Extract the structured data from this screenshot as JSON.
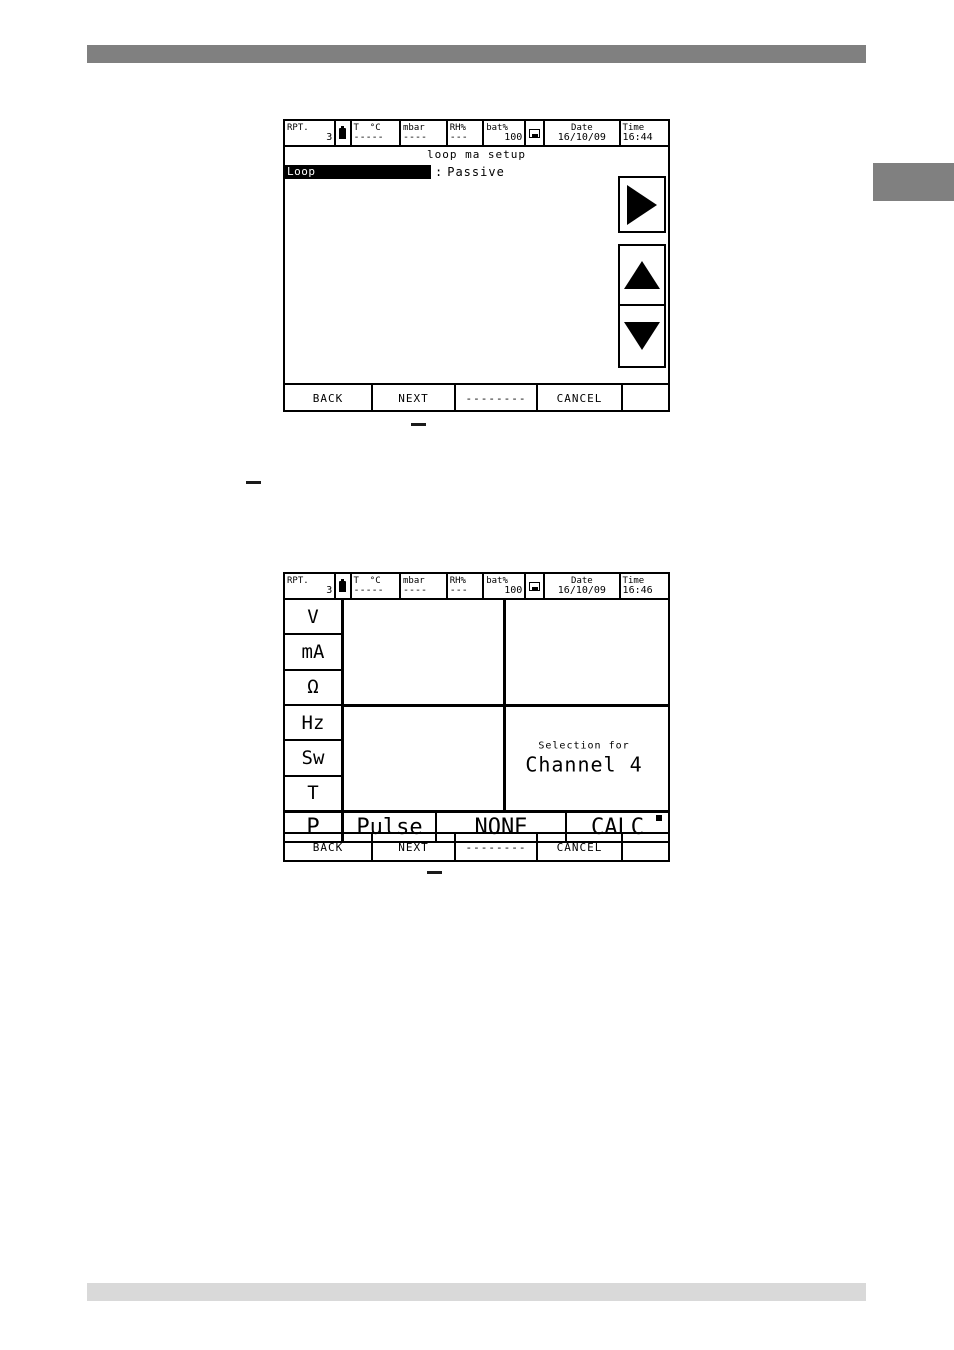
{
  "page": {
    "top_bar_color": "#808080",
    "bottom_bar_color": "#d9d9d9",
    "side_tab_color": "#808080"
  },
  "screens": [
    {
      "id": "loop-ma-setup",
      "status_bar": {
        "rpt_label": "RPT.",
        "rpt_value": "3",
        "battery_icon": "battery-icon",
        "temp_label": "T  °C",
        "temp_value": "-----",
        "mbar_label": "mbar",
        "mbar_value": "----",
        "rh_label": "RH%",
        "rh_value": "---",
        "batt_label": "bat%",
        "batt_value": "100",
        "memory_icon": "memory-card-icon",
        "date_label": "Date",
        "date_value": "16/10/09",
        "time_label": "Time",
        "time_value": "16:44"
      },
      "title": "loop ma setup",
      "field": {
        "label": "Loop",
        "separator": ":",
        "value": "Passive"
      },
      "arrow_keys": [
        {
          "name": "right-arrow-button",
          "glyph": "right-triangle-icon"
        },
        {
          "name": "up-arrow-button",
          "glyph": "up-triangle-icon"
        },
        {
          "name": "down-arrow-button",
          "glyph": "down-triangle-icon"
        }
      ],
      "softkeys": [
        {
          "label": "BACK"
        },
        {
          "label": "NEXT"
        },
        {
          "label": "--------"
        },
        {
          "label": "CANCEL"
        },
        {
          "label": ""
        }
      ]
    },
    {
      "id": "channel-selection",
      "status_bar": {
        "rpt_label": "RPT.",
        "rpt_value": "3",
        "battery_icon": "battery-icon",
        "temp_label": "T  °C",
        "temp_value": "-----",
        "mbar_label": "mbar",
        "mbar_value": "----",
        "rh_label": "RH%",
        "rh_value": "---",
        "batt_label": "bat%",
        "batt_value": "100",
        "memory_icon": "memory-card-icon",
        "date_label": "Date",
        "date_value": "16/10/09",
        "time_label": "Time",
        "time_value": "16:46"
      },
      "unit_keys": [
        {
          "label": "V"
        },
        {
          "label": "mA"
        },
        {
          "label": "Ω"
        },
        {
          "label": "Hz"
        },
        {
          "label": "Sw"
        },
        {
          "label": "T"
        }
      ],
      "selection": {
        "caption": "Selection for",
        "channel": "Channel 4"
      },
      "function_keys": [
        {
          "label": "P"
        },
        {
          "label": "Pulse"
        },
        {
          "label": "NONE"
        },
        {
          "label": "CALC",
          "badge": "active-dot"
        }
      ],
      "softkeys": [
        {
          "label": "BACK"
        },
        {
          "label": "NEXT"
        },
        {
          "label": "--------"
        },
        {
          "label": "CANCEL"
        },
        {
          "label": ""
        }
      ]
    }
  ]
}
